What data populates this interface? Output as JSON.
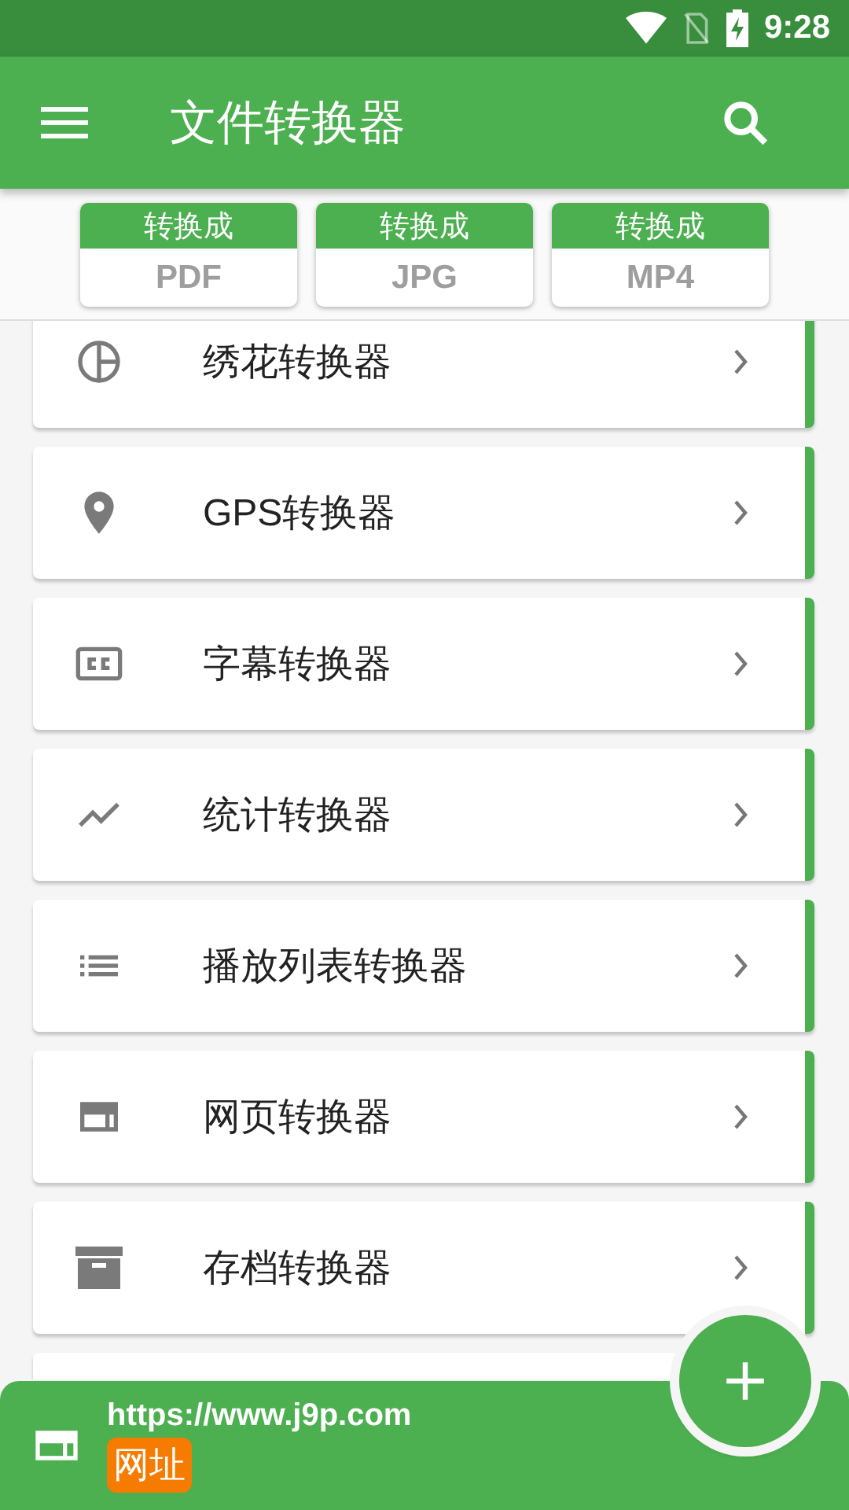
{
  "status_bar": {
    "time": "9:28"
  },
  "app_bar": {
    "title": "文件转换器"
  },
  "quick_convert": [
    {
      "label": "转换成",
      "format": "PDF"
    },
    {
      "label": "转换成",
      "format": "JPG"
    },
    {
      "label": "转换成",
      "format": "MP4"
    }
  ],
  "converters": [
    {
      "name": "绣花转换器"
    },
    {
      "name": "GPS转换器"
    },
    {
      "name": "字幕转换器"
    },
    {
      "name": "统计转换器"
    },
    {
      "name": "播放列表转换器"
    },
    {
      "name": "网页转换器"
    },
    {
      "name": "存档转换器"
    }
  ],
  "bottom_bar": {
    "url": "https://www.j9p.com",
    "tag": "网址"
  }
}
